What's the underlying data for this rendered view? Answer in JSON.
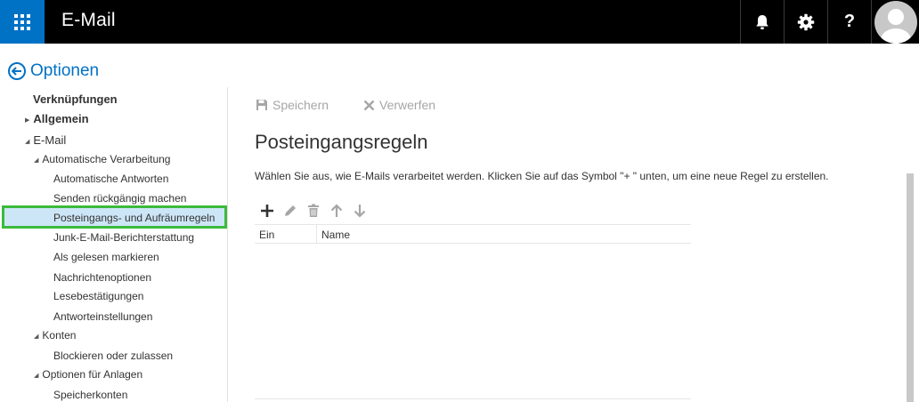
{
  "app": {
    "title": "E-Mail"
  },
  "topbar": {
    "icons": [
      "app-launcher-icon",
      "bell-icon",
      "gear-icon",
      "help-icon",
      "avatar-icon"
    ],
    "help_label": "?",
    "accent_color": "#0072c6"
  },
  "options": {
    "title": "Optionen"
  },
  "nav": {
    "links": "Verknüpfungen",
    "allgemein": "Allgemein",
    "email": "E-Mail",
    "auto_processing": "Automatische Verarbeitung",
    "auto_replies": "Automatische Antworten",
    "undo_send": "Senden rückgängig machen",
    "inbox_rules": "Posteingangs- und Aufräumregeln",
    "junk_reporting": "Junk-E-Mail-Berichterstattung",
    "mark_read": "Als gelesen markieren",
    "message_options": "Nachrichtenoptionen",
    "read_receipts": "Lesebestätigungen",
    "reply_settings": "Antworteinstellungen",
    "accounts": "Konten",
    "block_allow": "Blockieren oder zulassen",
    "attachment_options": "Optionen für Anlagen",
    "storage_accounts": "Speicherkonten"
  },
  "toolbar": {
    "save_label": "Speichern",
    "discard_label": "Verwerfen"
  },
  "main": {
    "title": "Posteingangsregeln",
    "description": "Wählen Sie aus, wie E-Mails verarbeitet werden. Klicken Sie auf das Symbol \"+ \" unten, um eine neue Regel zu erstellen.",
    "table": {
      "columns": [
        "Ein",
        "Name"
      ]
    }
  }
}
